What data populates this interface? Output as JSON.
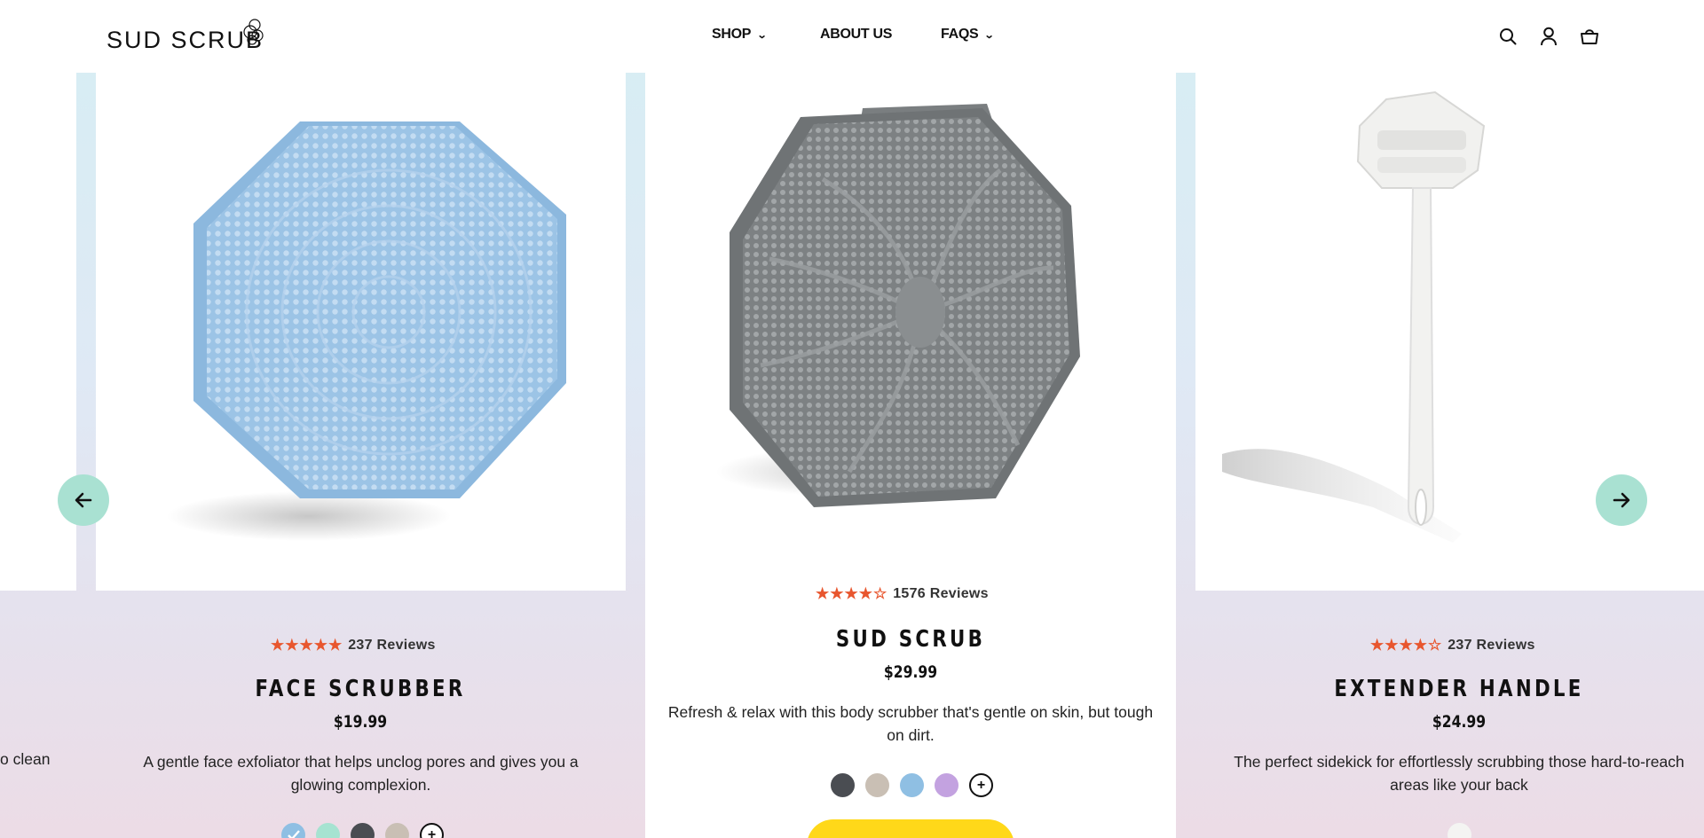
{
  "header": {
    "logo_text": "SUD SCRUB",
    "nav": [
      {
        "label": "SHOP",
        "has_dropdown": true
      },
      {
        "label": "ABOUT US",
        "has_dropdown": false
      },
      {
        "label": "FAQS",
        "has_dropdown": true
      }
    ],
    "icons": [
      "search-icon",
      "account-icon",
      "cart-icon"
    ]
  },
  "carousel": {
    "prev_icon": "arrow-left-icon",
    "next_icon": "arrow-right-icon",
    "partial_left_text": "o clean",
    "products": [
      {
        "name": "FACE SCRUBBER",
        "price": "$19.99",
        "rating": 5,
        "reviews": "237 Reviews",
        "description": "A gentle face exfoliator that helps unclog pores and gives you a glowing complexion.",
        "swatches": [
          "#8fbfe3",
          "#a6e3d1",
          "#4a4d52",
          "#c9bfb4"
        ],
        "selected_swatch": 0,
        "more_swatches_icon": "plus-icon"
      },
      {
        "name": "SUD SCRUB",
        "price": "$29.99",
        "rating": 4.5,
        "reviews": "1576 Reviews",
        "description": "Refresh & relax with this body scrubber that's gentle on skin, but tough on dirt.",
        "swatches": [
          "#4a4d52",
          "#c9bfb4",
          "#8fbfe3",
          "#c3a2e0"
        ],
        "more_swatches_icon": "plus-icon"
      },
      {
        "name": "EXTENDER HANDLE",
        "price": "$24.99",
        "rating": 4.5,
        "reviews": "237 Reviews",
        "description": "The perfect sidekick for effortlessly scrubbing those hard-to-reach areas like your back",
        "swatches": [
          "#f4f4f2"
        ]
      }
    ]
  },
  "colors": {
    "accent_star": "#e8562e",
    "arrow_bg": "#a9e1d2",
    "cta_yellow": "#ffd819"
  }
}
